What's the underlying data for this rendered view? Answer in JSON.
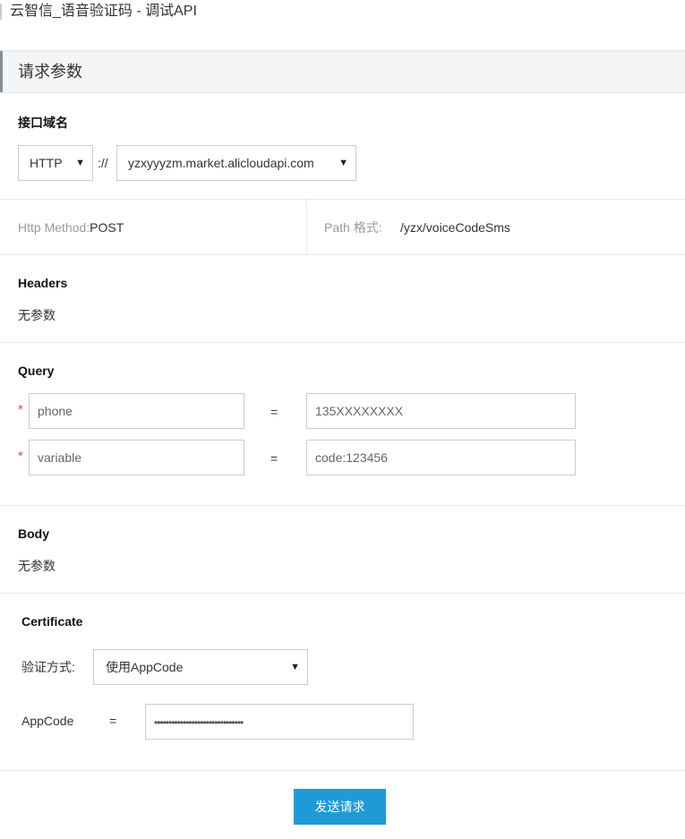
{
  "header": {
    "title": "云智信_语音验证码 - 调试API"
  },
  "section": {
    "title": "请求参数"
  },
  "endpoint": {
    "label": "接口域名",
    "protocol": "HTTP",
    "separator": "://",
    "domain": "yzxyyyzm.market.alicloudapi.com"
  },
  "method": {
    "label": "Http Method:",
    "value": "POST"
  },
  "path": {
    "label": "Path 格式:",
    "value": "/yzx/voiceCodeSms"
  },
  "headers": {
    "label": "Headers",
    "empty": "无参数"
  },
  "query": {
    "label": "Query",
    "params": [
      {
        "name": "phone",
        "eq": "=",
        "value": "135XXXXXXXX"
      },
      {
        "name": "variable",
        "eq": "=",
        "value": "code:123456"
      }
    ]
  },
  "body": {
    "label": "Body",
    "empty": "无参数"
  },
  "certificate": {
    "label": "Certificate",
    "auth_label": "验证方式:",
    "auth_value": "使用AppCode",
    "appcode_label": "AppCode",
    "appcode_eq": "=",
    "appcode_value": "•••••••••••••••••••••••••••••••"
  },
  "actions": {
    "send": "发送请求"
  },
  "icons": {
    "caret": "▼"
  }
}
